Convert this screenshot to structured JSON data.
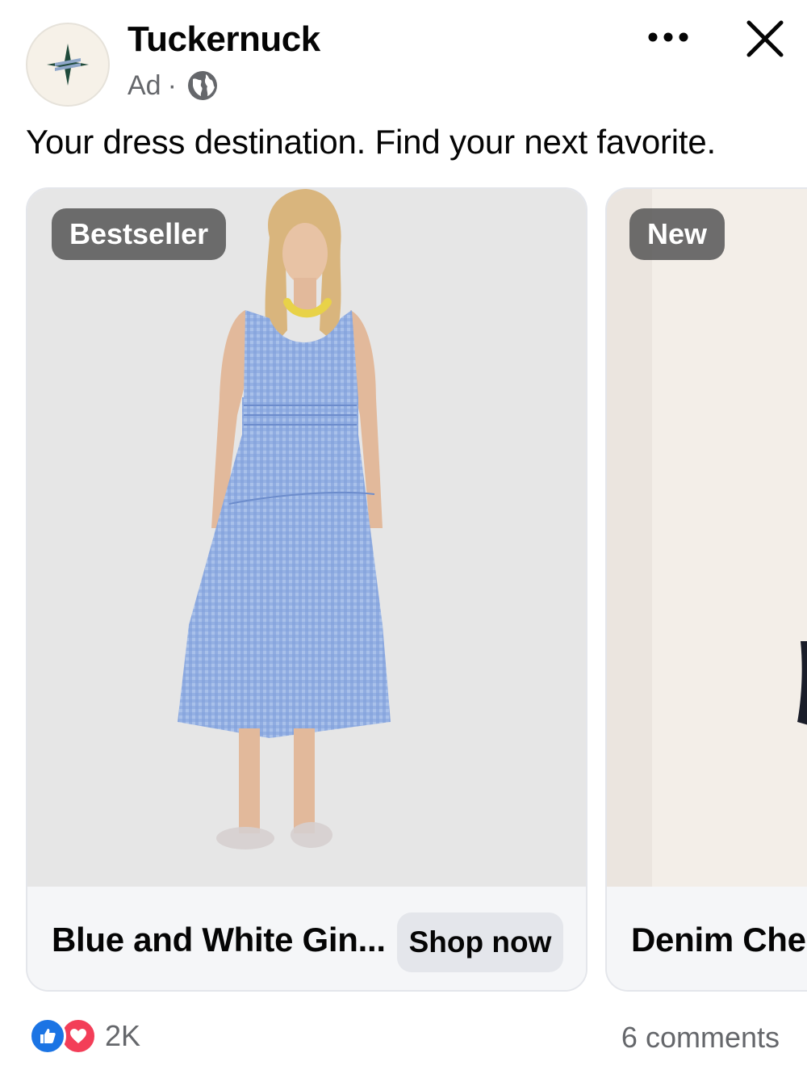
{
  "post": {
    "page_name": "Tuckernuck",
    "sponsored_label": "Ad",
    "separator": "·",
    "caption": "Your dress destination. Find your next favorite."
  },
  "icons": {
    "avatar": "tuckernuck-star-logo",
    "audience": "globe-icon",
    "more": "more-options-icon",
    "close": "close-icon",
    "like": "like-reaction-icon",
    "love": "love-reaction-icon"
  },
  "carousel": [
    {
      "badge": "Bestseller",
      "title": "Blue and White Gin...",
      "cta": "Shop now",
      "image": "woman in blue and white gingham tiered midi dress with yellow beaded necklace and clear flats"
    },
    {
      "badge": "New",
      "title": "Denim Ches",
      "image": "model in dark outfit against cream backdrop (partially visible)"
    }
  ],
  "engagement": {
    "reaction_count": "2K",
    "comments": "6 comments"
  },
  "colors": {
    "like_blue": "#1b74e4",
    "love_red": "#f33e58",
    "logo_green": "#1f4a3a",
    "secondary_text": "#65676b",
    "card_bg": "#f5f6f8"
  }
}
